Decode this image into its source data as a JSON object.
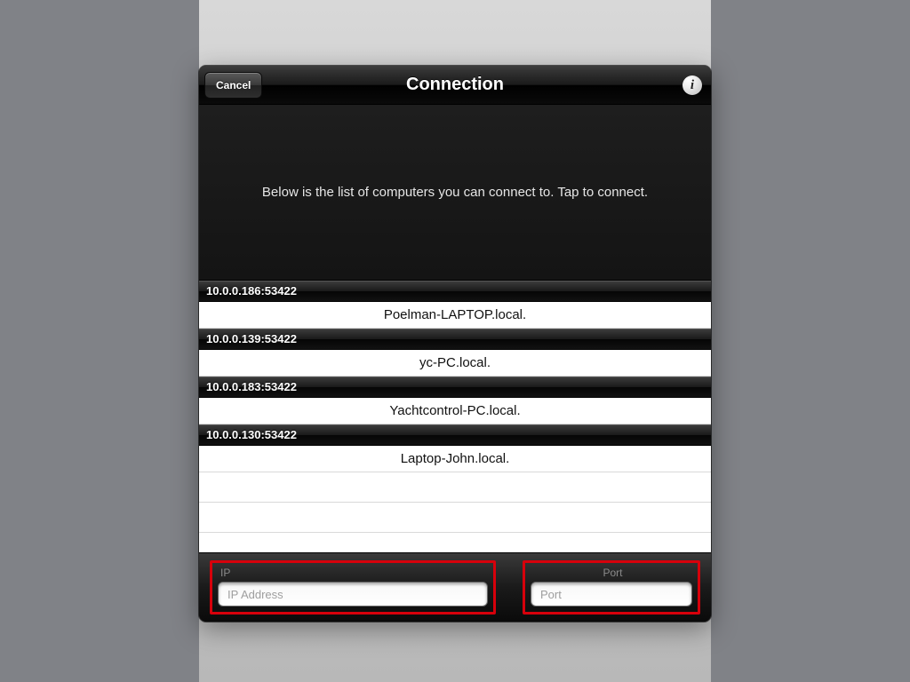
{
  "header": {
    "cancel_label": "Cancel",
    "title": "Connection",
    "info_glyph": "i"
  },
  "intro_text": "Below is the list of computers you can connect to. Tap to connect.",
  "computers": [
    {
      "address": "10.0.0.186:53422",
      "name": "Poelman-LAPTOP.local."
    },
    {
      "address": "10.0.0.139:53422",
      "name": "yc-PC.local."
    },
    {
      "address": "10.0.0.183:53422",
      "name": "Yachtcontrol-PC.local."
    },
    {
      "address": "10.0.0.130:53422",
      "name": "Laptop-John.local."
    }
  ],
  "inputs": {
    "ip": {
      "label": "IP",
      "placeholder": "IP Address",
      "value": ""
    },
    "port": {
      "label": "Port",
      "placeholder": "Port",
      "value": ""
    }
  }
}
